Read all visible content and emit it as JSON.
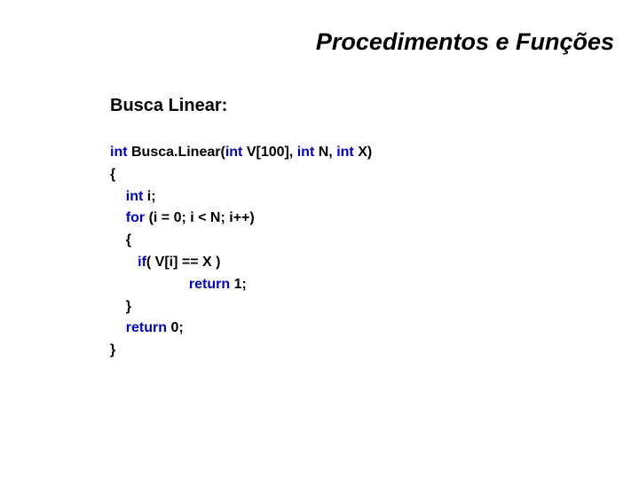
{
  "title": "Procedimentos e Funções",
  "subtitle": "Busca Linear:",
  "code": {
    "sig_kw1": "int",
    "sig_name": " Busca.Linear(",
    "sig_kw2": "int ",
    "sig_p1": "V[100], ",
    "sig_kw3": "int ",
    "sig_p2": "N, ",
    "sig_kw4": "int ",
    "sig_p3": "X)",
    "open_brace": "{",
    "decl_kw": "int ",
    "decl_rest": "i;",
    "for_kw": "for ",
    "for_rest": "(i = 0; i < N; i++)",
    "for_open": "{",
    "if_kw": "if",
    "if_rest": "( V[i] == X )",
    "ret1_kw": "return ",
    "ret1_rest": "1;",
    "for_close": "}",
    "ret0_kw": "return ",
    "ret0_rest": "0;",
    "close_brace": "}"
  }
}
